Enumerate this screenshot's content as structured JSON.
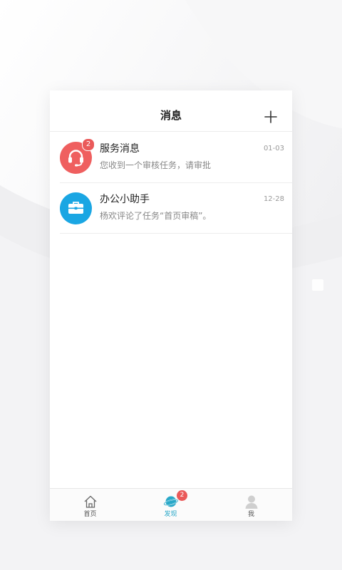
{
  "colors": {
    "service_avatar": "#ef5f5f",
    "assistant_avatar": "#1aa6e3",
    "badge": "#ea5a5a",
    "active_tab": "#29a8c8"
  },
  "header": {
    "title": "消息",
    "action_icon": "plus-icon"
  },
  "messages": [
    {
      "title": "服务消息",
      "preview": "您收到一个审核任务，请审批",
      "date": "01-03",
      "badge": "2",
      "icon": "headset-icon"
    },
    {
      "title": "办公小助手",
      "preview": "杨欢评论了任务“首页审稿”。",
      "date": "12-28",
      "icon": "briefcase-icon"
    }
  ],
  "tabbar": {
    "items": [
      {
        "label": "首页",
        "icon": "home-icon"
      },
      {
        "label": "发现",
        "icon": "discover-planet-icon",
        "badge": "2",
        "active": true
      },
      {
        "label": "我",
        "icon": "user-icon"
      }
    ]
  }
}
